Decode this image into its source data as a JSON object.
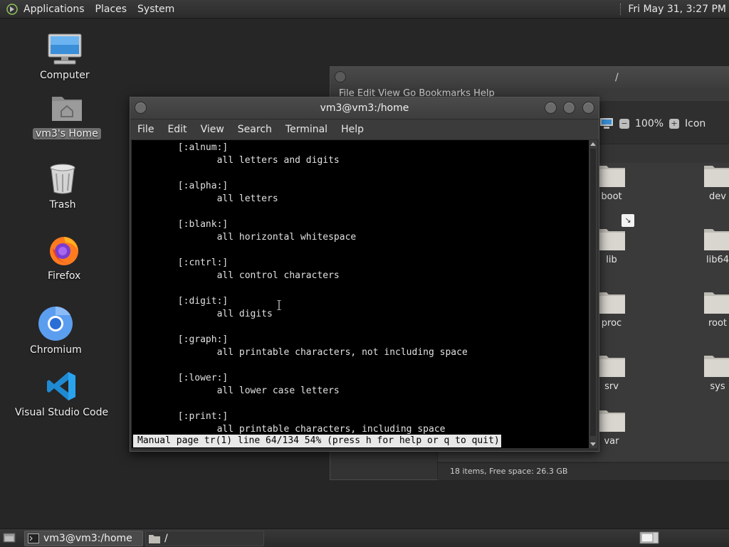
{
  "top_panel": {
    "menus": [
      "Applications",
      "Places",
      "System"
    ],
    "clock": "Fri May 31,  3:27 PM"
  },
  "desktop": {
    "icons": [
      {
        "label": "Computer",
        "icon": "computer-icon"
      },
      {
        "label": "vm3's Home",
        "icon": "home-folder-icon",
        "selected": true
      },
      {
        "label": "Trash",
        "icon": "trash-icon"
      },
      {
        "label": "Firefox",
        "icon": "firefox-icon"
      },
      {
        "label": "Chromium",
        "icon": "chromium-icon"
      },
      {
        "label": "Visual Studio Code",
        "icon": "vscode-icon"
      }
    ]
  },
  "file_manager": {
    "title": "/",
    "menu_partial": "File   Edit   View   Go   Bookmarks   Help",
    "zoom": "100%",
    "view_mode": "Icon",
    "folders": [
      "boot",
      "dev",
      "lib",
      "lib64",
      "proc",
      "root",
      "srv",
      "sys",
      "var"
    ],
    "status": "18 items, Free space: 26.3 GB"
  },
  "terminal": {
    "title": "vm3@vm3:/home",
    "menus": [
      "File",
      "Edit",
      "View",
      "Search",
      "Terminal",
      "Help"
    ],
    "lines": [
      "       [:alnum:]",
      "              all letters and digits",
      "",
      "       [:alpha:]",
      "              all letters",
      "",
      "       [:blank:]",
      "              all horizontal whitespace",
      "",
      "       [:cntrl:]",
      "              all control characters",
      "",
      "       [:digit:]",
      "              all digits",
      "",
      "       [:graph:]",
      "              all printable characters, not including space",
      "",
      "       [:lower:]",
      "              all lower case letters",
      "",
      "       [:print:]",
      "              all printable characters, including space"
    ],
    "status_line": "Manual page tr(1) line 64/134 54% (press h for help or q to quit)"
  },
  "taskbar": {
    "tasks": [
      {
        "label": "vm3@vm3:/home",
        "active": true
      },
      {
        "label": "/",
        "active": false
      }
    ]
  },
  "colors": {
    "desktop_bg": "#262626",
    "terminal_bg": "#000000",
    "folder": "#d8d6cf"
  }
}
